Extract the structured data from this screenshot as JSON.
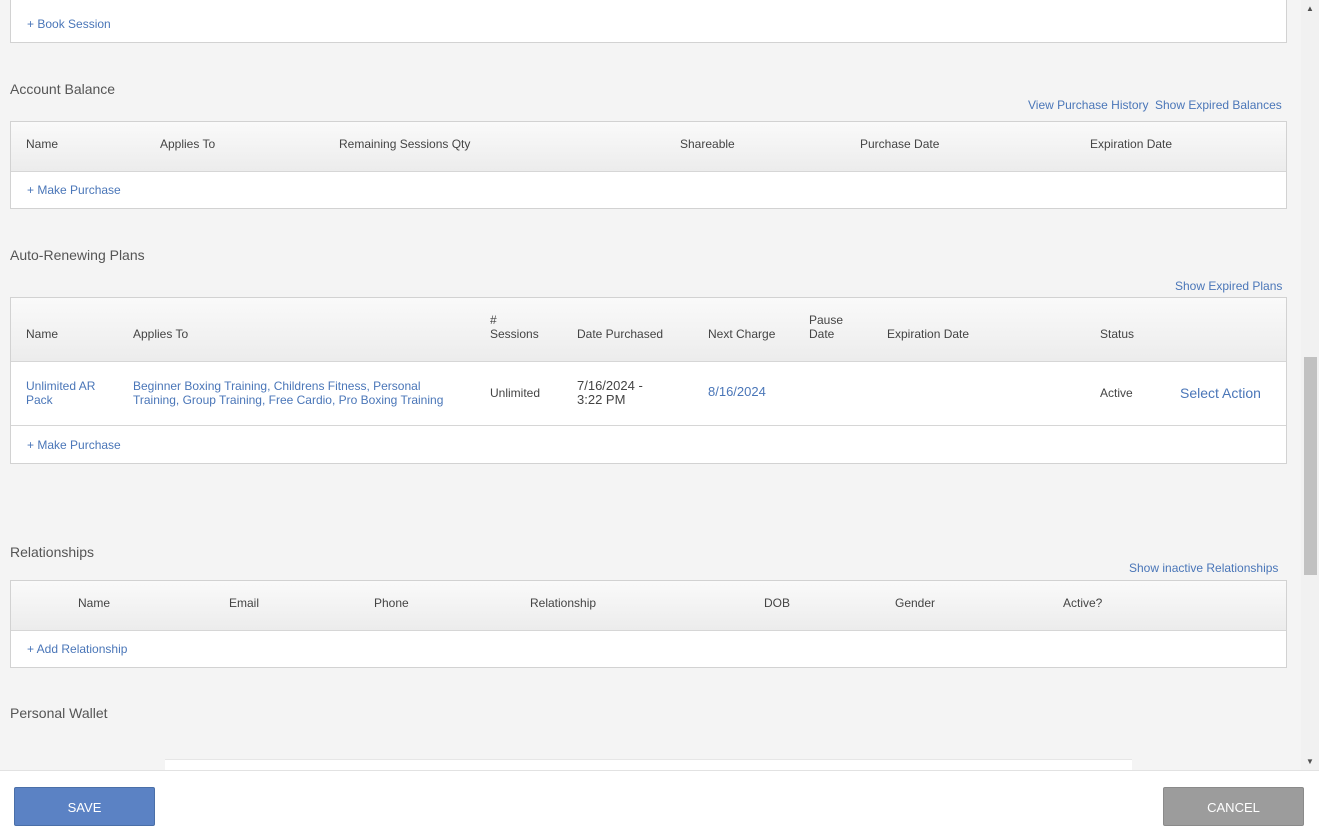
{
  "sessions": {
    "book_session": "+ Book Session"
  },
  "account_balance": {
    "title": "Account Balance",
    "view_purchase_history": "View Purchase History",
    "show_expired_balances": "Show Expired Balances",
    "columns": [
      "Name",
      "Applies To",
      "Remaining Sessions Qty",
      "Shareable",
      "Purchase Date",
      "Expiration Date"
    ],
    "make_purchase": "+ Make Purchase"
  },
  "auto_renewing": {
    "title": "Auto-Renewing Plans",
    "show_expired_plans": "Show Expired Plans",
    "columns": {
      "name": "Name",
      "applies_to": "Applies To",
      "sessions_1": "#",
      "sessions_2": "Sessions",
      "date_purchased": "Date Purchased",
      "next_charge": "Next Charge",
      "pause_1": "Pause",
      "pause_2": "Date",
      "expiration_date": "Expiration Date",
      "status": "Status"
    },
    "row": {
      "name_1": "Unlimited AR",
      "name_2": "Pack",
      "applies_1": "Beginner Boxing Training, Childrens Fitness, Personal",
      "applies_2": "Training, Group Training, Free Cardio, Pro Boxing Training",
      "sessions": "Unlimited",
      "date_1": "7/16/2024 -",
      "date_2": "3:22 PM",
      "next_charge": "8/16/2024",
      "status": "Active",
      "action": "Select Action"
    },
    "make_purchase": "+ Make Purchase"
  },
  "relationships": {
    "title": "Relationships",
    "show_inactive": "Show inactive Relationships",
    "columns": [
      "Name",
      "Email",
      "Phone",
      "Relationship",
      "DOB",
      "Gender",
      "Active?"
    ],
    "add_relationship": "+ Add Relationship"
  },
  "personal_wallet": {
    "title": "Personal Wallet"
  },
  "footer": {
    "save": "SAVE",
    "cancel": "CANCEL"
  }
}
